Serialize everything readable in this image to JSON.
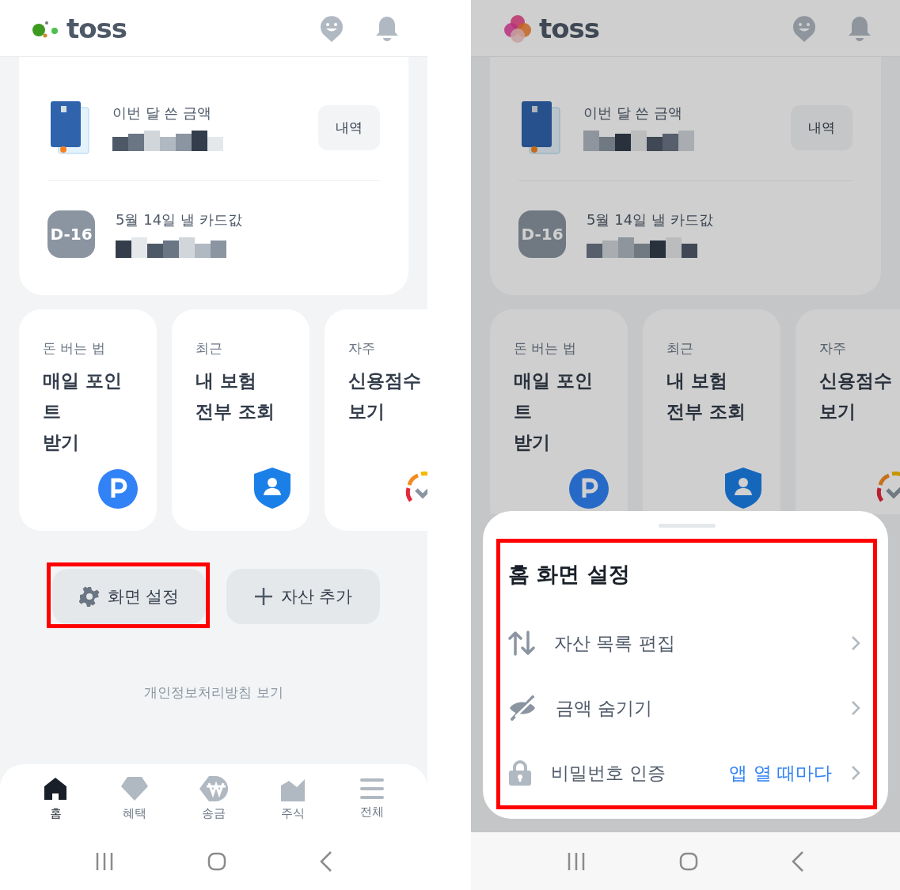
{
  "screens": [
    {
      "header": {
        "logo": {
          "kind": "dots",
          "text": "toss"
        }
      },
      "summary": [
        {
          "kind": "card",
          "label": "이번 달 쓴 금액",
          "button": "내역"
        },
        {
          "kind": "due",
          "badge": "D-16",
          "label": "5월 14일 낼 카드값"
        }
      ],
      "shortcuts": [
        {
          "kind": "points",
          "caption": "돈 버는 법",
          "title_lines": [
            "매일 포인",
            "트",
            "받기"
          ]
        },
        {
          "kind": "insurance",
          "caption": "최근",
          "title_lines": [
            "내 보험",
            "전부 조회"
          ]
        },
        {
          "kind": "credit",
          "caption": "자주",
          "title_lines": [
            "신용점수",
            "보기"
          ]
        }
      ],
      "actions": [
        {
          "kind": "settings",
          "label": "화면 설정",
          "highlighted": true
        },
        {
          "kind": "add",
          "label": "자산 추가",
          "highlighted": false
        }
      ],
      "footer_link": "개인정보처리방침 보기",
      "nav": [
        {
          "kind": "home",
          "label": "홈",
          "selected": true
        },
        {
          "kind": "gem",
          "label": "혜택",
          "selected": false
        },
        {
          "kind": "won",
          "label": "송금",
          "selected": false
        },
        {
          "kind": "stock",
          "label": "주식",
          "selected": false
        },
        {
          "kind": "menu",
          "label": "전체",
          "selected": false
        }
      ]
    },
    {
      "header": {
        "logo": {
          "kind": "flower",
          "text": "toss"
        }
      },
      "dimmed": true,
      "summary": [
        {
          "kind": "card",
          "label": "이번 달 쓴 금액",
          "button": "내역"
        },
        {
          "kind": "due",
          "badge": "D-16",
          "label": "5월 14일 낼 카드값"
        }
      ],
      "shortcuts": [
        {
          "kind": "points",
          "caption": "돈 버는 법",
          "title_lines": [
            "매일 포인",
            "트",
            "받기"
          ]
        },
        {
          "kind": "insurance",
          "caption": "최근",
          "title_lines": [
            "내 보험",
            "전부 조회"
          ]
        },
        {
          "kind": "credit",
          "caption": "자주",
          "title_lines": [
            "신용점수",
            "보기"
          ]
        }
      ],
      "sheet": {
        "title": "홈 화면 설정",
        "highlighted": true,
        "items": [
          {
            "kind": "reorder",
            "label": "자산 목록 편집"
          },
          {
            "kind": "hide",
            "label": "금액 숨기기"
          },
          {
            "kind": "lock",
            "label": "비밀번호 인증",
            "value": "앱 열 때마다"
          }
        ]
      }
    }
  ]
}
